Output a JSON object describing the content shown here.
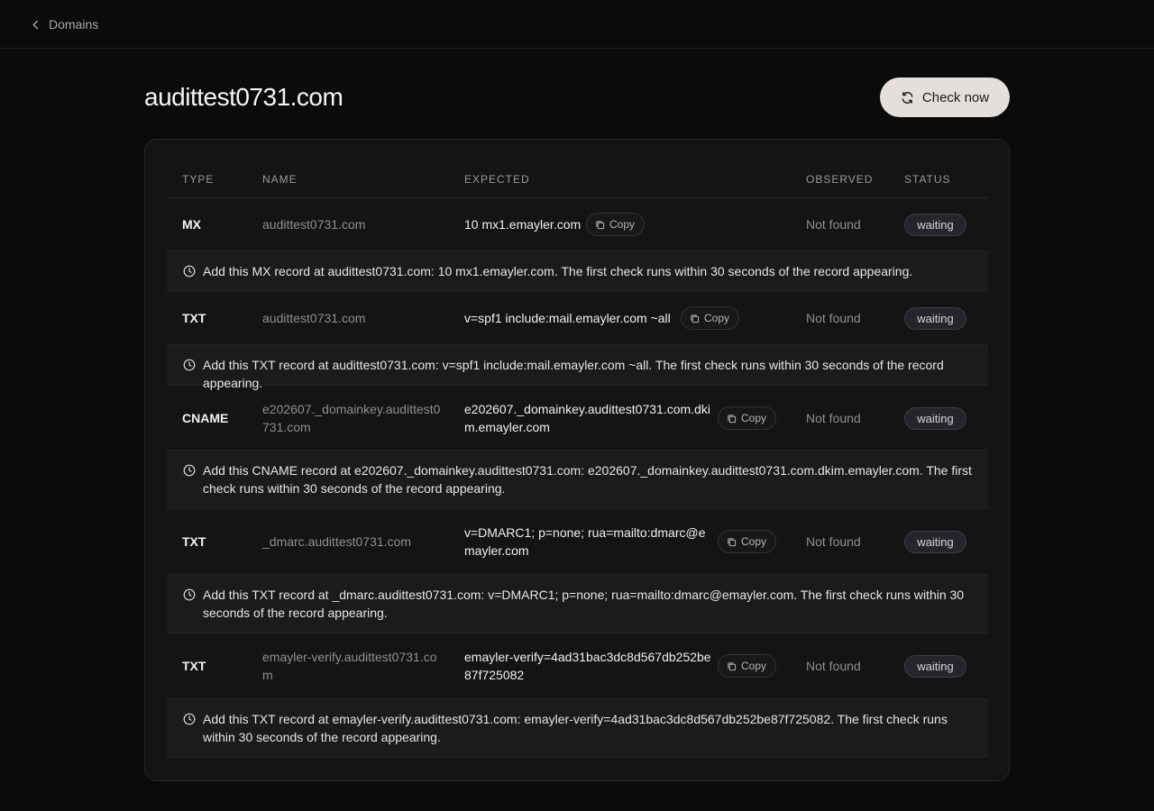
{
  "nav": {
    "back_label": "Domains"
  },
  "page": {
    "title": "audittest0731.com",
    "check_label": "Check now"
  },
  "table": {
    "headers": {
      "type": "TYPE",
      "name": "NAME",
      "expected": "EXPECTED",
      "observed": "OBSERVED",
      "status": "STATUS"
    },
    "copy_label": "Copy",
    "rows": [
      {
        "type": "MX",
        "name": "audittest0731.com",
        "expected": "10 mx1.emayler.com",
        "observed": "Not found",
        "status": "waiting",
        "hint": "Add this MX record at audittest0731.com: 10 mx1.emayler.com. The first check runs within 30 seconds of the record appearing."
      },
      {
        "type": "TXT",
        "name": "audittest0731.com",
        "expected": "v=spf1 include:mail.emayler.com ~all",
        "observed": "Not found",
        "status": "waiting",
        "hint": "Add this TXT record at audittest0731.com: v=spf1 include:mail.emayler.com ~all. The first check runs within 30 seconds of the record appearing."
      },
      {
        "type": "CNAME",
        "name": "e202607._domainkey.audittest0731.com",
        "expected": "e202607._domainkey.audittest0731.com.dkim.emayler.com",
        "observed": "Not found",
        "status": "waiting",
        "hint": "Add this CNAME record at e202607._domainkey.audittest0731.com: e202607._domainkey.audittest0731.com.dkim.emayler.com. The first check runs within 30 seconds of the record appearing."
      },
      {
        "type": "TXT",
        "name": "_dmarc.audittest0731.com",
        "expected": "v=DMARC1; p=none; rua=mailto:dmarc@emayler.com",
        "observed": "Not found",
        "status": "waiting",
        "hint": "Add this TXT record at _dmarc.audittest0731.com: v=DMARC1; p=none; rua=mailto:dmarc@emayler.com. The first check runs within 30 seconds of the record appearing."
      },
      {
        "type": "TXT",
        "name": "emayler-verify.audittest0731.com",
        "expected": "emayler-verify=4ad31bac3dc8d567db252be87f725082",
        "observed": "Not found",
        "status": "waiting",
        "hint": "Add this TXT record at emayler-verify.audittest0731.com: emayler-verify=4ad31bac3dc8d567db252be87f725082. The first check runs within 30 seconds of the record appearing."
      }
    ]
  }
}
